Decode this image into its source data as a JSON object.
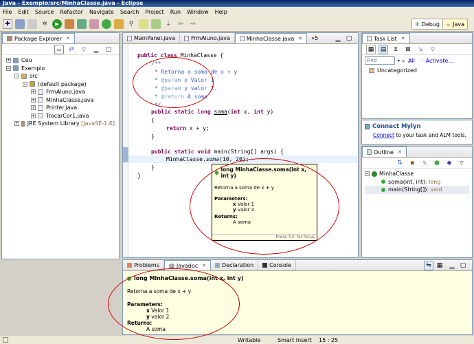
{
  "window": {
    "title": "Java - Exemplo/src/MinhaClasse.java - Eclipse"
  },
  "menu": [
    "File",
    "Edit",
    "Source",
    "Refactor",
    "Navigate",
    "Search",
    "Project",
    "Run",
    "Window",
    "Help"
  ],
  "perspectives": {
    "debug": "Debug",
    "java": "Java"
  },
  "package_explorer": {
    "title": "Package Explorer",
    "tree": [
      {
        "label": "Ceu",
        "level": 0
      },
      {
        "label": "Exemplo",
        "level": 0
      },
      {
        "label": "src",
        "level": 1
      },
      {
        "label": "(default package)",
        "level": 2
      },
      {
        "label": "FrmAluno.java",
        "level": 3
      },
      {
        "label": "MinhaClasse.java",
        "level": 3
      },
      {
        "label": "Printer.java",
        "level": 3
      },
      {
        "label": "TrocarCor1.java",
        "level": 3
      },
      {
        "label": "JRE System Library",
        "level": 1,
        "extra": "[JavaSE-1.6]"
      }
    ]
  },
  "editor": {
    "tabs": [
      "MainPanel.java",
      "FrmAluno.java",
      "MinhaClasse.java",
      "»5"
    ],
    "lines": [
      {
        "k": "public class ",
        "t": "MinhaClasse {"
      },
      {
        "c": "/**"
      },
      {
        "c": " * Retorna a soma de x + y"
      },
      {
        "c": " * ",
        "tag": "@param",
        "r": " x Valor 1"
      },
      {
        "c": " * ",
        "tag": "@param",
        "r": " y valor 2."
      },
      {
        "c": " * ",
        "tag": "@return",
        "r": " A soma"
      },
      {
        "c": " */"
      },
      {
        "t": "public static long soma(int x, int y)"
      },
      {
        "t": "{"
      },
      {
        "t": "return x + y;"
      },
      {
        "t": "}"
      },
      {
        "t": ""
      },
      {
        "t": "public static void main(String[] args) {"
      },
      {
        "t": "MinhaClasse.soma(10, 20);"
      },
      {
        "t": "}"
      },
      {
        "t": "}"
      }
    ]
  },
  "hover": {
    "signature": "long MinhaClasse.soma(int x, int y)",
    "description": "Retorna a soma de x + y",
    "params_label": "Parameters:",
    "p1_name": "x",
    "p1_desc": "Valor 1",
    "p2_name": "y",
    "p2_desc": "valor 2.",
    "returns_label": "Returns:",
    "returns_desc": "A soma",
    "footer": "Press 'F2' for focus"
  },
  "task_list": {
    "title": "Task List",
    "find_placeholder": "Find",
    "all_label": "All",
    "activate_label": "Activate...",
    "category": "Uncategorized"
  },
  "mylyn": {
    "title": "Connect Mylyn",
    "link": "Connect",
    "text": " to your task and ALM tools."
  },
  "outline": {
    "title": "Outline",
    "items": [
      {
        "label": "MinhaClasse",
        "suffix": ""
      },
      {
        "label": "soma(int, int)",
        "suffix": " : long"
      },
      {
        "label": "main(String[])",
        "suffix": " : void"
      }
    ]
  },
  "bottom_tabs": [
    "Problems",
    "Javadoc",
    "Declaration",
    "Console"
  ],
  "javadoc": {
    "signature": "long MinhaClasse.soma(int x, int y)",
    "description": "Retorna a soma de x + y",
    "params_label": "Parameters:",
    "p1_name": "x",
    "p1_desc": "Valor 1",
    "p2_name": "y",
    "p2_desc": "valor 2.",
    "returns_label": "Returns:",
    "returns_desc": "A soma"
  },
  "status": {
    "writable": "Writable",
    "insert": "Smart Insert",
    "position": "15 : 25"
  },
  "colors": {
    "keyword": "#7f0055",
    "comment": "#3f5fbf",
    "annotation_ellipse": "#d00000",
    "hover_bg": "#ffffe1"
  }
}
